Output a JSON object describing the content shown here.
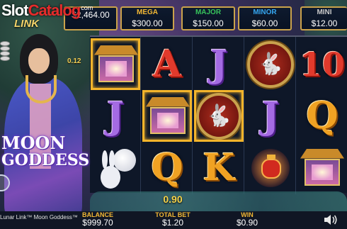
{
  "brand": {
    "part1": "Slot",
    "part2": "Catalog",
    "suffix": "com"
  },
  "logo_fragment": "LINK",
  "jackpots": [
    {
      "label": "",
      "value": "$2,464.00",
      "color": "#f3b834"
    },
    {
      "label": "MEGA",
      "value": "$300.00",
      "color": "#f3b834"
    },
    {
      "label": "MAJOR",
      "value": "$150.00",
      "color": "#37c35b"
    },
    {
      "label": "MINOR",
      "value": "$60.00",
      "color": "#35a6f0"
    },
    {
      "label": "MINI",
      "value": "$12.00",
      "color": "#c9c9c9"
    }
  ],
  "stake_indicator": "0.12",
  "game_title": {
    "line1": "MOON",
    "line2": "GODDESS"
  },
  "reels": [
    [
      "pavilion",
      "J",
      "moon-rabbit"
    ],
    [
      "A",
      "pavilion",
      "Q"
    ],
    [
      "J",
      "wild",
      "K"
    ],
    [
      "wild",
      "J",
      "lantern"
    ],
    [
      "10",
      "Q",
      "pavilion"
    ]
  ],
  "win_amount": "0.90",
  "bottom_bar": {
    "game_name": "Lunar Link™ Moon Goddess™",
    "balance_label": "BALANCE",
    "balance_value": "$999.70",
    "bet_label": "TOTAL BET",
    "bet_value": "$1.20",
    "win_label": "WIN",
    "win_value": "$0.90"
  },
  "icons": {
    "coins": "coins-icon",
    "spin": "spin-icon",
    "sound": "speaker-icon"
  }
}
